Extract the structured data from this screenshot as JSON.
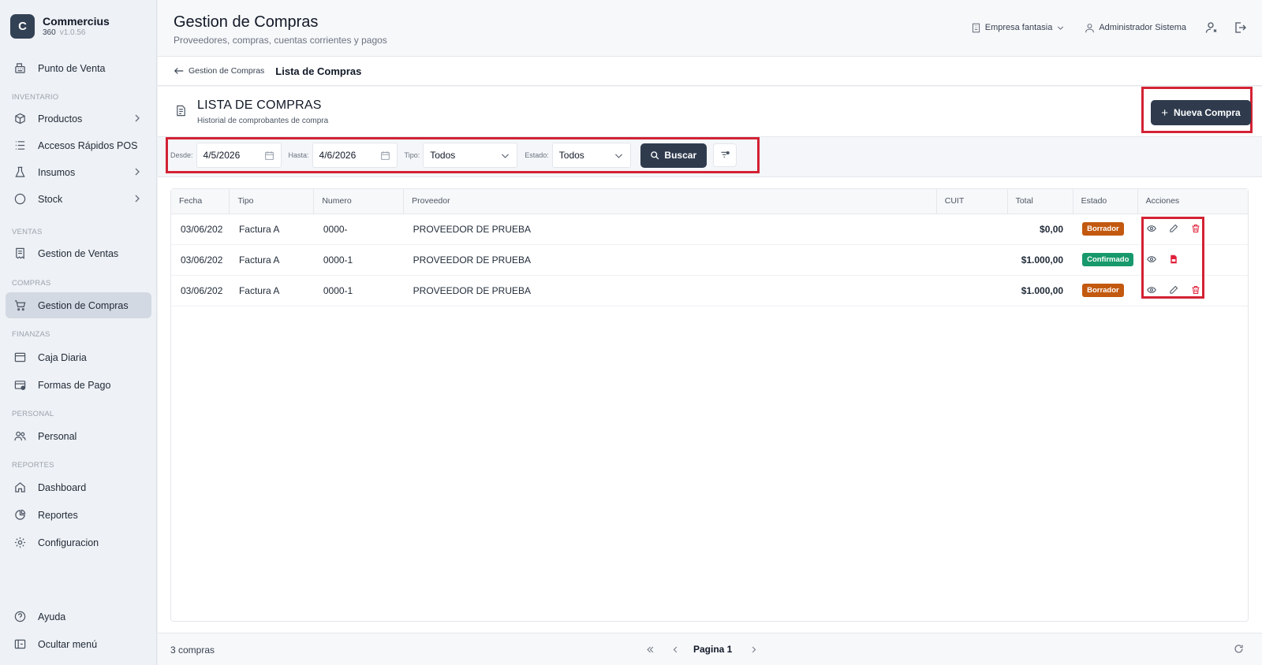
{
  "app": {
    "logo_letter": "C",
    "name": "Commercius",
    "edition": "360",
    "version": "v1.0.56"
  },
  "sidebar": {
    "pos": {
      "label": "Punto de Venta",
      "icon": "register-icon"
    },
    "sections": {
      "inventario": "INVENTARIO",
      "ventas": "VENTAS",
      "compras": "COMPRAS",
      "finanzas": "FINANZAS",
      "personal": "PERSONAL",
      "reportes": "REPORTES"
    },
    "items": {
      "productos": "Productos",
      "accesos": "Accesos Rápidos POS",
      "insumos": "Insumos",
      "stock": "Stock",
      "ventas": "Gestion de Ventas",
      "compras": "Gestion de Compras",
      "caja": "Caja Diaria",
      "formas": "Formas de Pago",
      "personal": "Personal",
      "dashboard": "Dashboard",
      "reportes": "Reportes",
      "configuracion": "Configuracion",
      "ayuda": "Ayuda",
      "ocultar": "Ocultar menú"
    }
  },
  "header": {
    "title": "Gestion de Compras",
    "subtitle": "Proveedores, compras, cuentas corrientes y pagos",
    "company": "Empresa fantasia",
    "user": "Administrador Sistema"
  },
  "breadcrumb": {
    "back": "Gestion de Compras",
    "current": "Lista de Compras"
  },
  "section": {
    "title": "LISTA DE COMPRAS",
    "subtitle": "Historial de comprobantes de compra",
    "new_button": "Nueva Compra"
  },
  "filters": {
    "desde_label": "Desde:",
    "desde_value": "4/5/2026",
    "hasta_label": "Hasta:",
    "hasta_value": "4/6/2026",
    "tipo_label": "Tipo:",
    "tipo_value": "Todos",
    "estado_label": "Estado:",
    "estado_value": "Todos",
    "search_button": "Buscar"
  },
  "table": {
    "headers": [
      "Fecha",
      "Tipo",
      "Numero",
      "Proveedor",
      "CUIT",
      "Total",
      "Estado",
      "Acciones"
    ],
    "rows": [
      {
        "fecha": "03/06/202",
        "tipo": "Factura A",
        "numero": "0000-",
        "proveedor": "PROVEEDOR DE PRUEBA",
        "cuit": "",
        "total": "$0,00",
        "estado": "Borrador"
      },
      {
        "fecha": "03/06/202",
        "tipo": "Factura A",
        "numero": "0000-1",
        "proveedor": "PROVEEDOR DE PRUEBA",
        "cuit": "",
        "total": "$1.000,00",
        "estado": "Confirmado"
      },
      {
        "fecha": "03/06/202",
        "tipo": "Factura A",
        "numero": "0000-1",
        "proveedor": "PROVEEDOR DE PRUEBA",
        "cuit": "",
        "total": "$1.000,00",
        "estado": "Borrador"
      }
    ]
  },
  "footer": {
    "count": "3 compras",
    "page": "Pagina 1"
  },
  "colors": {
    "primary": "#2f3b4d",
    "draft": "#c2590f",
    "confirmed": "#17996b",
    "highlight": "#d32234",
    "danger": "#e0213a"
  }
}
